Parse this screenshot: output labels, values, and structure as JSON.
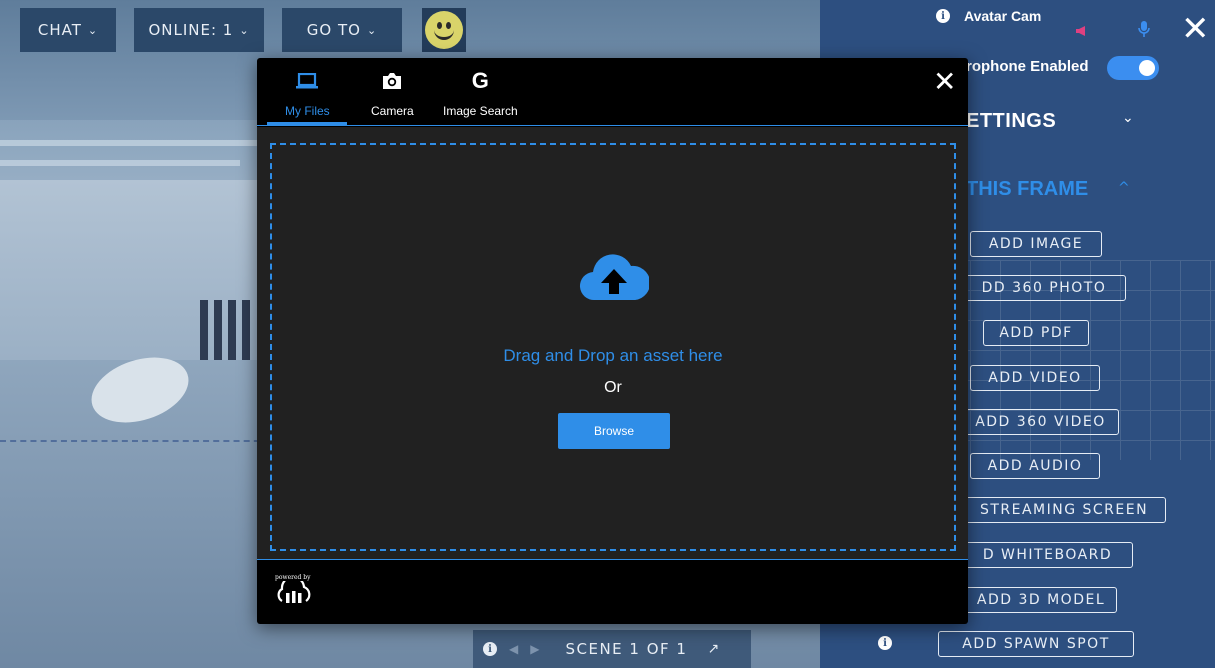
{
  "toolbar": {
    "chat_label": "CHAT",
    "online_label": "ONLINE: 1",
    "goto_label": "GO TO"
  },
  "panel": {
    "avatar_cam_label": "Avatar Cam",
    "microphone_label": "rophone Enabled",
    "microphone_enabled": true,
    "settings_heading": "ETTINGS",
    "frame_heading": "THIS FRAME",
    "add_buttons": [
      "ADD IMAGE",
      "DD 360 PHOTO",
      "ADD PDF",
      "ADD VIDEO",
      "ADD 360 VIDEO",
      "ADD AUDIO",
      "STREAMING SCREEN",
      "D WHITEBOARD",
      "ADD 3D MODEL",
      "ADD SPAWN SPOT"
    ]
  },
  "scene_bar": {
    "label": "SCENE 1 OF 1"
  },
  "modal": {
    "tabs": [
      {
        "label": "My Files",
        "icon": "laptop-icon",
        "active": true
      },
      {
        "label": "Camera",
        "icon": "camera-icon",
        "active": false
      },
      {
        "label": "Image Search",
        "icon": "google-icon",
        "active": false
      }
    ],
    "dropzone_text": "Drag and Drop an asset here",
    "or_text": "Or",
    "browse_label": "Browse",
    "powered_by": "powered by"
  },
  "colors": {
    "accent": "#2f8ee8",
    "panel_bg": "#2d4f80",
    "modal_body": "#212121"
  }
}
